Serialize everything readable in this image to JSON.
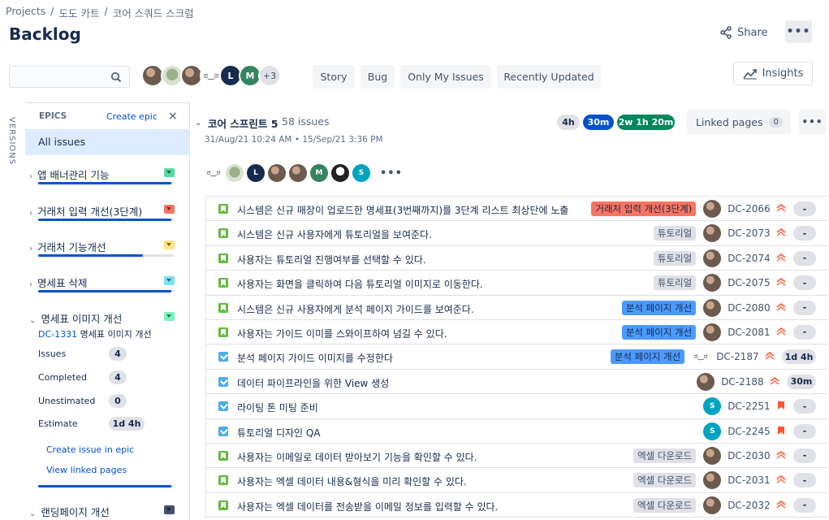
{
  "breadcrumb": [
    "Projects",
    "도도 카트",
    "코어 스쿼드 스크럼"
  ],
  "page_title": "Backlog",
  "header": {
    "share_label": "Share",
    "more_label": "•••"
  },
  "toolbar": {
    "search_placeholder": "",
    "avatar_more": "+3",
    "avatar_initials": [
      "L",
      "M"
    ],
    "filters": [
      "Story",
      "Bug",
      "Only My Issues",
      "Recently Updated"
    ],
    "insights_label": "Insights"
  },
  "versions_label": "VERSIONS",
  "epics": {
    "heading": "EPICS",
    "create_label": "Create epic",
    "close_label": "×",
    "all_issues_label": "All issues",
    "items": [
      {
        "name": "앱 배너관리 기능",
        "color": "#57d9a3",
        "progress": 0.98
      },
      {
        "name": "거래처 입력 개선(3단계)",
        "color": "#f87462",
        "progress": 0.98
      },
      {
        "name": "거래처 기능개선",
        "color": "#ffe380",
        "progress": 0.77
      },
      {
        "name": "명세표 삭제",
        "color": "#79e2f2",
        "progress": 0.98
      },
      {
        "name": "명세표 이미지 개선",
        "color": "#79f2c0",
        "progress": 0.98
      },
      {
        "name": "랜딩페이지 개선",
        "color": "#42526e",
        "progress": 0
      }
    ],
    "expanded": {
      "key": "DC-1331",
      "summary": "명세표 이미지 개선",
      "stats": [
        {
          "label": "Issues",
          "value": "4"
        },
        {
          "label": "Completed",
          "value": "4"
        },
        {
          "label": "Unestimated",
          "value": "0"
        },
        {
          "label": "Estimate",
          "value": "1d 4h"
        }
      ],
      "actions": [
        "Create issue in epic",
        "View linked pages"
      ]
    }
  },
  "sprint": {
    "name": "코어 스프린트 5",
    "count": "58 issues",
    "dates": "31/Aug/21 10:24 AM • 15/Sep/21 3:36 PM",
    "estimates": {
      "todo": "4h",
      "in_progress": "30m",
      "done": "2w 1h 20m"
    },
    "linked_pages_label": "Linked pages",
    "linked_pages_count": "0",
    "more_label": "•••",
    "avatar_initials": [
      "L",
      "M",
      "S"
    ]
  },
  "issues": [
    {
      "type": "story",
      "summary": "시스템은 신규 매장이 업로드한 명세표(3번째까지)를 3단계 리스트 최상단에 노출",
      "epic": "거래처 입력 개선(3단계)",
      "epic_bg": "#f87462",
      "epic_fg": "#172b4d",
      "assignee": "photo",
      "key": "DC-2066",
      "priority": "high",
      "estimate": "-"
    },
    {
      "type": "story",
      "summary": "시스템은 신규 사용자에게 튜토리얼을 보여준다.",
      "epic": "튜토리얼",
      "epic_bg": "#dfe1e6",
      "epic_fg": "#42526e",
      "assignee": "photo",
      "key": "DC-2073",
      "priority": "high",
      "estimate": "-"
    },
    {
      "type": "story",
      "summary": "사용자는 튜토리얼 진행여부를 선택할 수 있다.",
      "epic": "튜토리얼",
      "epic_bg": "#dfe1e6",
      "epic_fg": "#42526e",
      "assignee": "photo",
      "key": "DC-2074",
      "priority": "high",
      "estimate": "-"
    },
    {
      "type": "story",
      "summary": "사용자는 화면을 클릭하여 다음 튜토리얼 이미지로 이동한다.",
      "epic": "튜토리얼",
      "epic_bg": "#dfe1e6",
      "epic_fg": "#42526e",
      "assignee": "photo",
      "key": "DC-2075",
      "priority": "high",
      "estimate": "-"
    },
    {
      "type": "story",
      "summary": "시스템은 신규 사용자에게 분석 페이지 가이드를 보여준다.",
      "epic": "분석 페이지 개선",
      "epic_bg": "#4c9aff",
      "epic_fg": "#172b4d",
      "assignee": "photo",
      "key": "DC-2080",
      "priority": "high",
      "estimate": "-"
    },
    {
      "type": "story",
      "summary": "사용자는 가이드 이미를 스와이프하여 넘길 수 있다.",
      "epic": "분석 페이지 개선",
      "epic_bg": "#4c9aff",
      "epic_fg": "#172b4d",
      "assignee": "photo",
      "key": "DC-2081",
      "priority": "high",
      "estimate": "-"
    },
    {
      "type": "task",
      "summary": "분석 페이지 가이드 이미지를 수정한다",
      "epic": "분석 페이지 개선",
      "epic_bg": "#4c9aff",
      "epic_fg": "#172b4d",
      "assignee": "sketch",
      "key": "DC-2187",
      "priority": "high",
      "estimate": "1d 4h"
    },
    {
      "type": "task",
      "summary": "데이터 파이프라인을 위한 View 생성",
      "epic": "",
      "epic_bg": "",
      "epic_fg": "",
      "assignee": "photo",
      "key": "DC-2188",
      "priority": "high",
      "estimate": "30m"
    },
    {
      "type": "task",
      "summary": "라이팅 톤 미팅 준비",
      "epic": "",
      "epic_bg": "",
      "epic_fg": "",
      "assignee": "teal",
      "assignee_initial": "S",
      "key": "DC-2251",
      "priority": "highest",
      "estimate": "-"
    },
    {
      "type": "task",
      "summary": "튜토리얼 디자인 QA",
      "epic": "",
      "epic_bg": "",
      "epic_fg": "",
      "assignee": "teal",
      "assignee_initial": "S",
      "key": "DC-2245",
      "priority": "highest",
      "estimate": "-"
    },
    {
      "type": "story",
      "summary": "사용자는 이메일로 데이터 받아보기 기능을 확인할 수 있다.",
      "epic": "엑셀 다운로드",
      "epic_bg": "#dfe1e6",
      "epic_fg": "#42526e",
      "assignee": "photo",
      "key": "DC-2030",
      "priority": "high",
      "estimate": "-"
    },
    {
      "type": "story",
      "summary": "사용자는 엑셀 데이터 내용&형식을 미리 확인할 수 있다.",
      "epic": "엑셀 다운로드",
      "epic_bg": "#dfe1e6",
      "epic_fg": "#42526e",
      "assignee": "photo",
      "key": "DC-2031",
      "priority": "high",
      "estimate": "-"
    },
    {
      "type": "story",
      "summary": "사용자는 엑셀 데이터를 전송받을 이메일 정보를 입력할 수 있다.",
      "epic": "엑셀 다운로드",
      "epic_bg": "#dfe1e6",
      "epic_fg": "#42526e",
      "assignee": "photo",
      "key": "DC-2032",
      "priority": "high",
      "estimate": "-"
    }
  ]
}
